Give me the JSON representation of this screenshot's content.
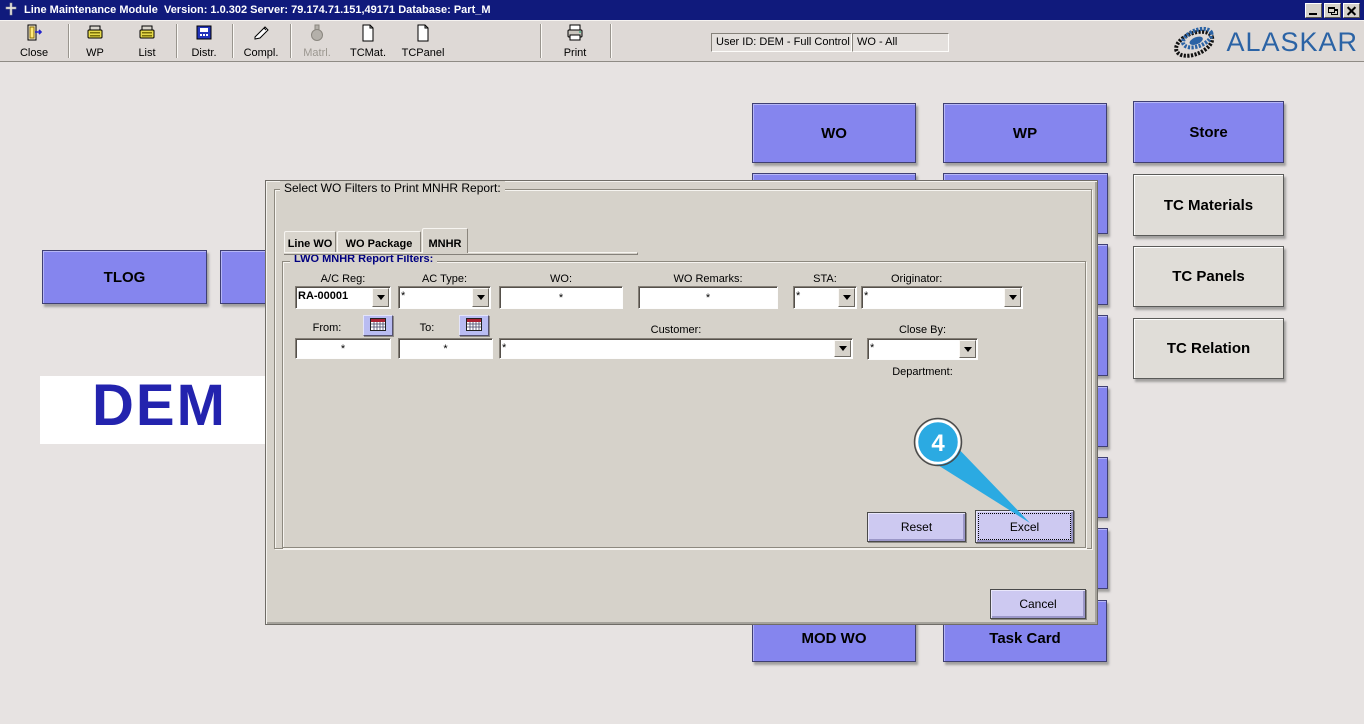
{
  "window": {
    "title": "Line Maintenance Module  Version: 1.0.302 Server: 79.174.71.151,49171 Database: Part_M",
    "icon": "app-cross-icon",
    "controls": [
      "minimize-icon",
      "restore-icon",
      "close-icon"
    ]
  },
  "toolbar": {
    "buttons": [
      {
        "label": "Close",
        "icon": "exit-door-icon",
        "disabled": false
      },
      {
        "label": "WP",
        "icon": "printer-yellow-icon",
        "disabled": false
      },
      {
        "label": "List",
        "icon": "printer-yellow-icon",
        "disabled": false
      },
      {
        "label": "Distr.",
        "icon": "distribution-disk-icon",
        "disabled": false
      },
      {
        "label": "Compl.",
        "icon": "hand-sign-icon",
        "disabled": false
      },
      {
        "label": "Matrl.",
        "icon": "flask-icon",
        "disabled": true
      },
      {
        "label": "TCMat.",
        "icon": "document-icon",
        "disabled": false
      },
      {
        "label": "TCPanel",
        "icon": "document-icon",
        "disabled": false
      },
      {
        "label": "Print",
        "icon": "printer-icon",
        "disabled": false
      }
    ],
    "user_box": "User ID: DEM - Full Control",
    "wo_box": "WO - All"
  },
  "logo": {
    "text": "ALASKAR",
    "icon": "alaskar-swoosh-icon"
  },
  "main": {
    "buttons": {
      "wo": "WO",
      "wp": "WP",
      "store": "Store",
      "tc_materials": "TC Materials",
      "tc_panels": "TC Panels",
      "tc_relation": "TC Relation",
      "tlog": "TLOG",
      "mod_wo": "MOD WO",
      "task_card": "Task Card"
    },
    "demo_text": "DEM"
  },
  "dialog": {
    "title": "Select WO Filters to Print MNHR Report:",
    "tabs": [
      {
        "label": "Line WO",
        "selected": false
      },
      {
        "label": "WO Package",
        "selected": false
      },
      {
        "label": "MNHR",
        "selected": true
      }
    ],
    "group_title": "LWO MNHR Report Filters:",
    "fields": {
      "ac_reg": {
        "label": "A/C Reg:",
        "value": "RA-00001"
      },
      "ac_type": {
        "label": "AC Type:",
        "value": "*"
      },
      "wo": {
        "label": "WO:",
        "value": "*"
      },
      "wo_remarks": {
        "label": "WO Remarks:",
        "value": "*"
      },
      "sta": {
        "label": "STA:",
        "value": "*"
      },
      "originator": {
        "label": "Originator:",
        "value": "*"
      },
      "from": {
        "label": "From:",
        "value": "*"
      },
      "to": {
        "label": "To:",
        "value": "*"
      },
      "customer": {
        "label": "Customer:",
        "value": "*"
      },
      "close_by": {
        "label": "Close By:",
        "value": "*"
      },
      "department": {
        "label": "Department:"
      }
    },
    "buttons": {
      "reset": "Reset",
      "excel": "Excel",
      "cancel": "Cancel"
    }
  },
  "annotation": {
    "number": "4",
    "color": "#2baae2"
  },
  "colors": {
    "titlebar": "#101a7c",
    "button_blue": "#8585ee",
    "button_lavender": "#cdc9f1",
    "dialog_bg": "#d6d2ca",
    "logo_blue": "#2b63a5",
    "demo_navy": "#2323ae"
  }
}
